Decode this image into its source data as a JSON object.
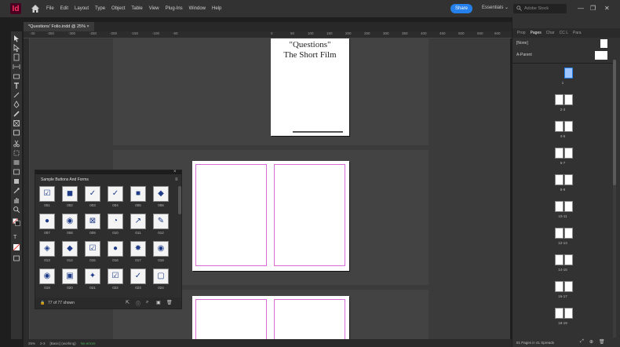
{
  "app": {
    "logo": "Id"
  },
  "menu": [
    "File",
    "Edit",
    "Layout",
    "Type",
    "Object",
    "Table",
    "View",
    "Plug-Ins",
    "Window",
    "Help"
  ],
  "toolbar_right": {
    "share": "Share",
    "workspace": "Essentials ⌄",
    "stock_placeholder": "Adobe Stock"
  },
  "document": {
    "tab_title": "*Questions' Folio.indd @ 25% ×"
  },
  "ruler": [
    "-40",
    "-350",
    "-300",
    "-250",
    "-200",
    "-150",
    "-100",
    "-50",
    "0",
    "50",
    "100",
    "150",
    "200",
    "250",
    "300",
    "350",
    "400",
    "450",
    "500",
    "550",
    "600",
    "650"
  ],
  "page1": {
    "line1": "\"Questions\"",
    "line2": "The Short Film"
  },
  "library": {
    "title": "Sample Buttons And Forms",
    "items": [
      {
        "label": "001",
        "glyph": "☑"
      },
      {
        "label": "002",
        "glyph": "◼"
      },
      {
        "label": "003",
        "glyph": "✓"
      },
      {
        "label": "004",
        "glyph": "✓"
      },
      {
        "label": "005",
        "glyph": "■"
      },
      {
        "label": "006",
        "glyph": "◆"
      },
      {
        "label": "007",
        "glyph": "●"
      },
      {
        "label": "008",
        "glyph": "◉"
      },
      {
        "label": "009",
        "glyph": "⊠"
      },
      {
        "label": "010",
        "glyph": "◔"
      },
      {
        "label": "011",
        "glyph": "↗"
      },
      {
        "label": "012",
        "glyph": "✎"
      },
      {
        "label": "013",
        "glyph": "◈"
      },
      {
        "label": "014",
        "glyph": "◆"
      },
      {
        "label": "015",
        "glyph": "☑"
      },
      {
        "label": "016",
        "glyph": "●"
      },
      {
        "label": "017",
        "glyph": "✸"
      },
      {
        "label": "018",
        "glyph": "◉"
      },
      {
        "label": "019",
        "glyph": "◉"
      },
      {
        "label": "020",
        "glyph": "▣"
      },
      {
        "label": "021",
        "glyph": "✦"
      },
      {
        "label": "022",
        "glyph": "☑"
      },
      {
        "label": "023",
        "glyph": "✓"
      },
      {
        "label": "024",
        "glyph": "▢"
      }
    ],
    "footer": "77 of 77 shown"
  },
  "pages_panel": {
    "tabs": [
      "Prop",
      "Pages",
      "Char",
      "CC L",
      "Para"
    ],
    "masters": [
      "[None]",
      "A-Parent"
    ],
    "pages": [
      {
        "label": "1"
      },
      {
        "label": "2-3"
      },
      {
        "label": "4-5"
      },
      {
        "label": "6-7"
      },
      {
        "label": "8-9"
      },
      {
        "label": "10-11"
      },
      {
        "label": "12-13"
      },
      {
        "label": "14-15"
      },
      {
        "label": "16-17"
      },
      {
        "label": "18-19"
      }
    ],
    "status": "81 Pages in 41 Spreads"
  },
  "statusbar": {
    "zoom": "25%",
    "page": "2-3",
    "preflight": "[Basic] (working)",
    "errors": "No errors"
  },
  "colors": {
    "accent": "#2680eb",
    "logo_bg": "#49021f",
    "logo_fg": "#ff3366",
    "margin": "#d96ad9"
  }
}
